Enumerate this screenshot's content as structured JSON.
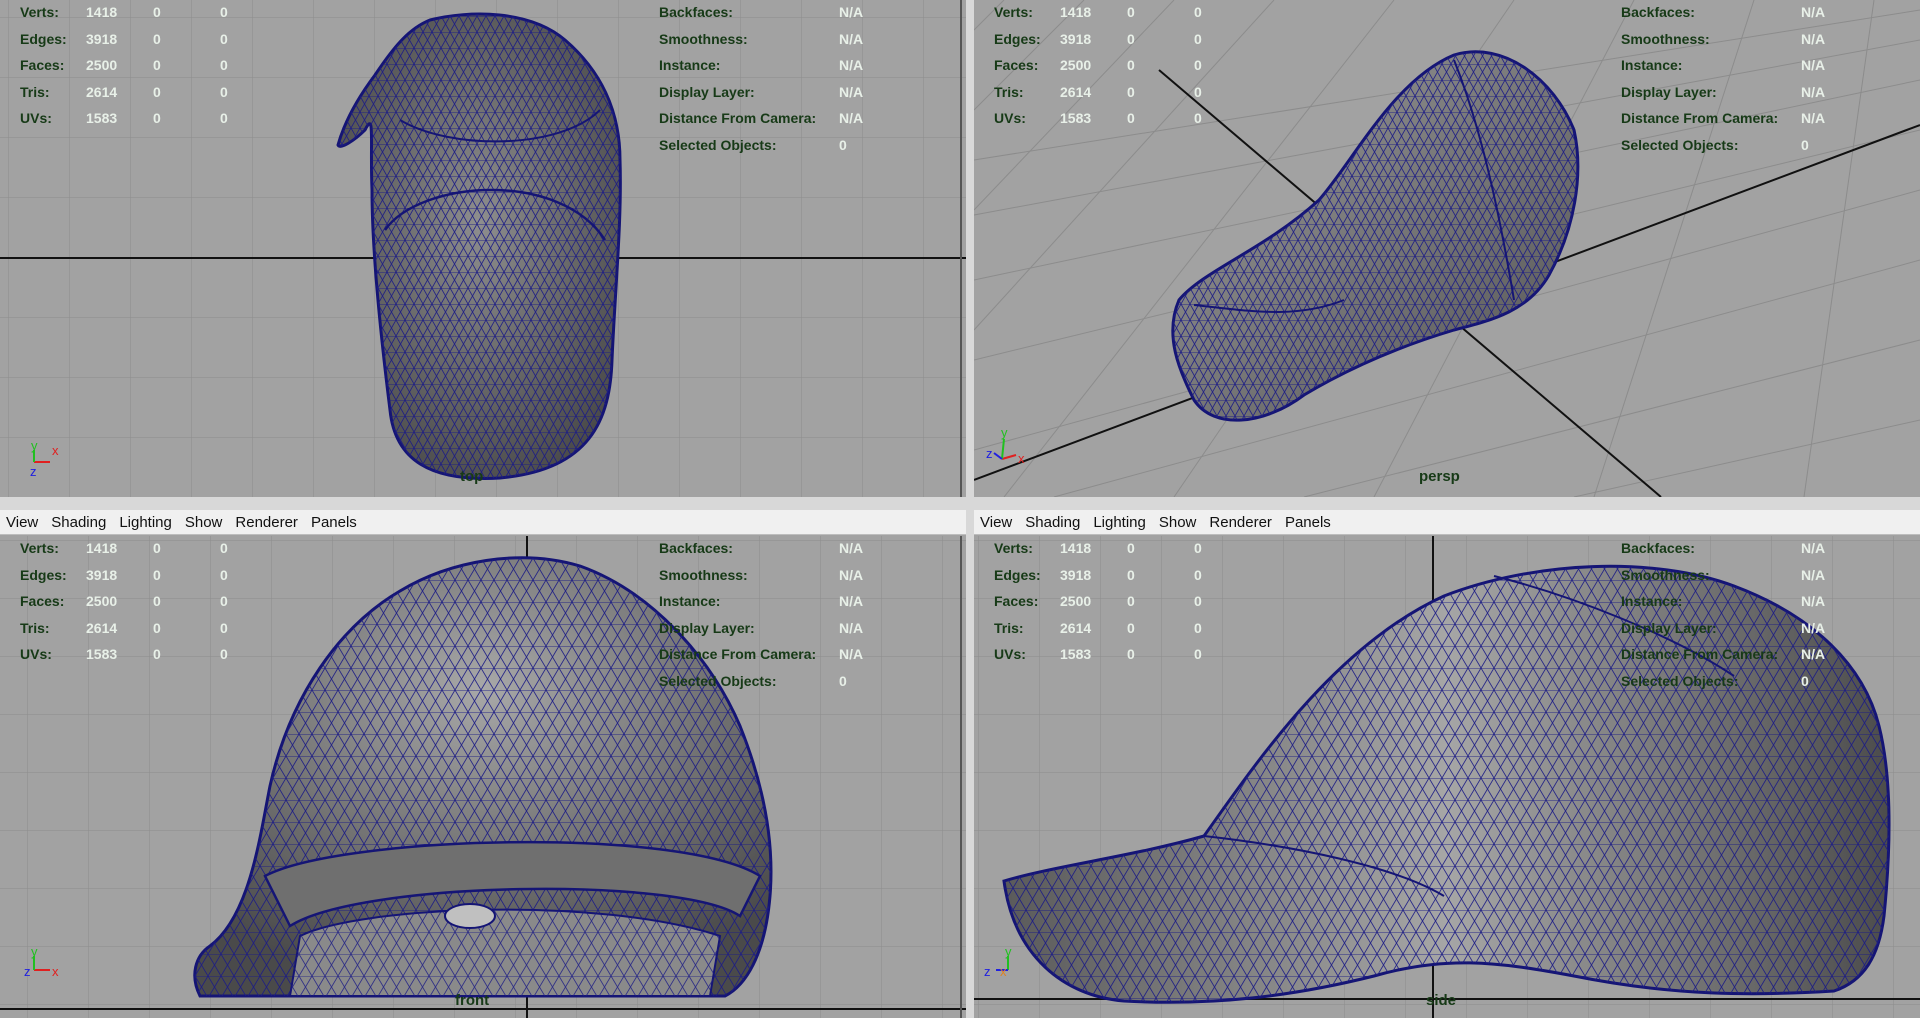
{
  "menu": [
    "View",
    "Shading",
    "Lighting",
    "Show",
    "Renderer",
    "Panels"
  ],
  "stats": [
    {
      "label": "Verts:",
      "values": [
        "1418",
        "0",
        "0"
      ]
    },
    {
      "label": "Edges:",
      "values": [
        "3918",
        "0",
        "0"
      ]
    },
    {
      "label": "Faces:",
      "values": [
        "2500",
        "0",
        "0"
      ]
    },
    {
      "label": "Tris:",
      "values": [
        "2614",
        "0",
        "0"
      ]
    },
    {
      "label": "UVs:",
      "values": [
        "1583",
        "0",
        "0"
      ]
    }
  ],
  "info": [
    {
      "label": "Backfaces:",
      "value": "N/A"
    },
    {
      "label": "Smoothness:",
      "value": "N/A"
    },
    {
      "label": "Instance:",
      "value": "N/A"
    },
    {
      "label": "Display Layer:",
      "value": "N/A"
    },
    {
      "label": "Distance From Camera:",
      "value": "N/A"
    },
    {
      "label": "Selected Objects:",
      "value": "0"
    }
  ],
  "cameras": {
    "top": "top",
    "persp": "persp",
    "front": "front",
    "side": "side"
  },
  "colors": {
    "viewport": "#a2a2a2",
    "hud_label": "#173a17",
    "wire": "#1a1a80",
    "mesh": "#7a7a7a",
    "menubar": "#f0f0f0"
  }
}
